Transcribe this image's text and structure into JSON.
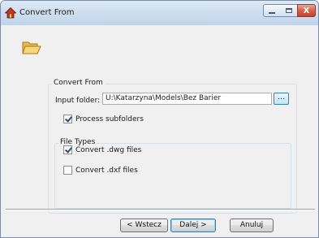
{
  "window": {
    "title": "Convert From",
    "close_glyph": "X"
  },
  "icons": {
    "app": "app-home-icon",
    "folder": "open-folder-icon"
  },
  "convert_group": {
    "legend": "Convert From",
    "input_folder_label": "Input folder:",
    "input_folder_value": "U:\\Katarzyna\\Models\\Bez Barier",
    "browse_label": "...",
    "process_subfolders_label": "Process subfolders",
    "process_subfolders_checked": true
  },
  "file_types": {
    "legend": "File Types",
    "dwg_label": "Convert .dwg files",
    "dwg_checked": true,
    "dxf_label": "Convert .dxf files",
    "dxf_checked": false
  },
  "buttons": {
    "back": "< Wstecz",
    "next": "Dalej >",
    "cancel": "Anuluj"
  }
}
